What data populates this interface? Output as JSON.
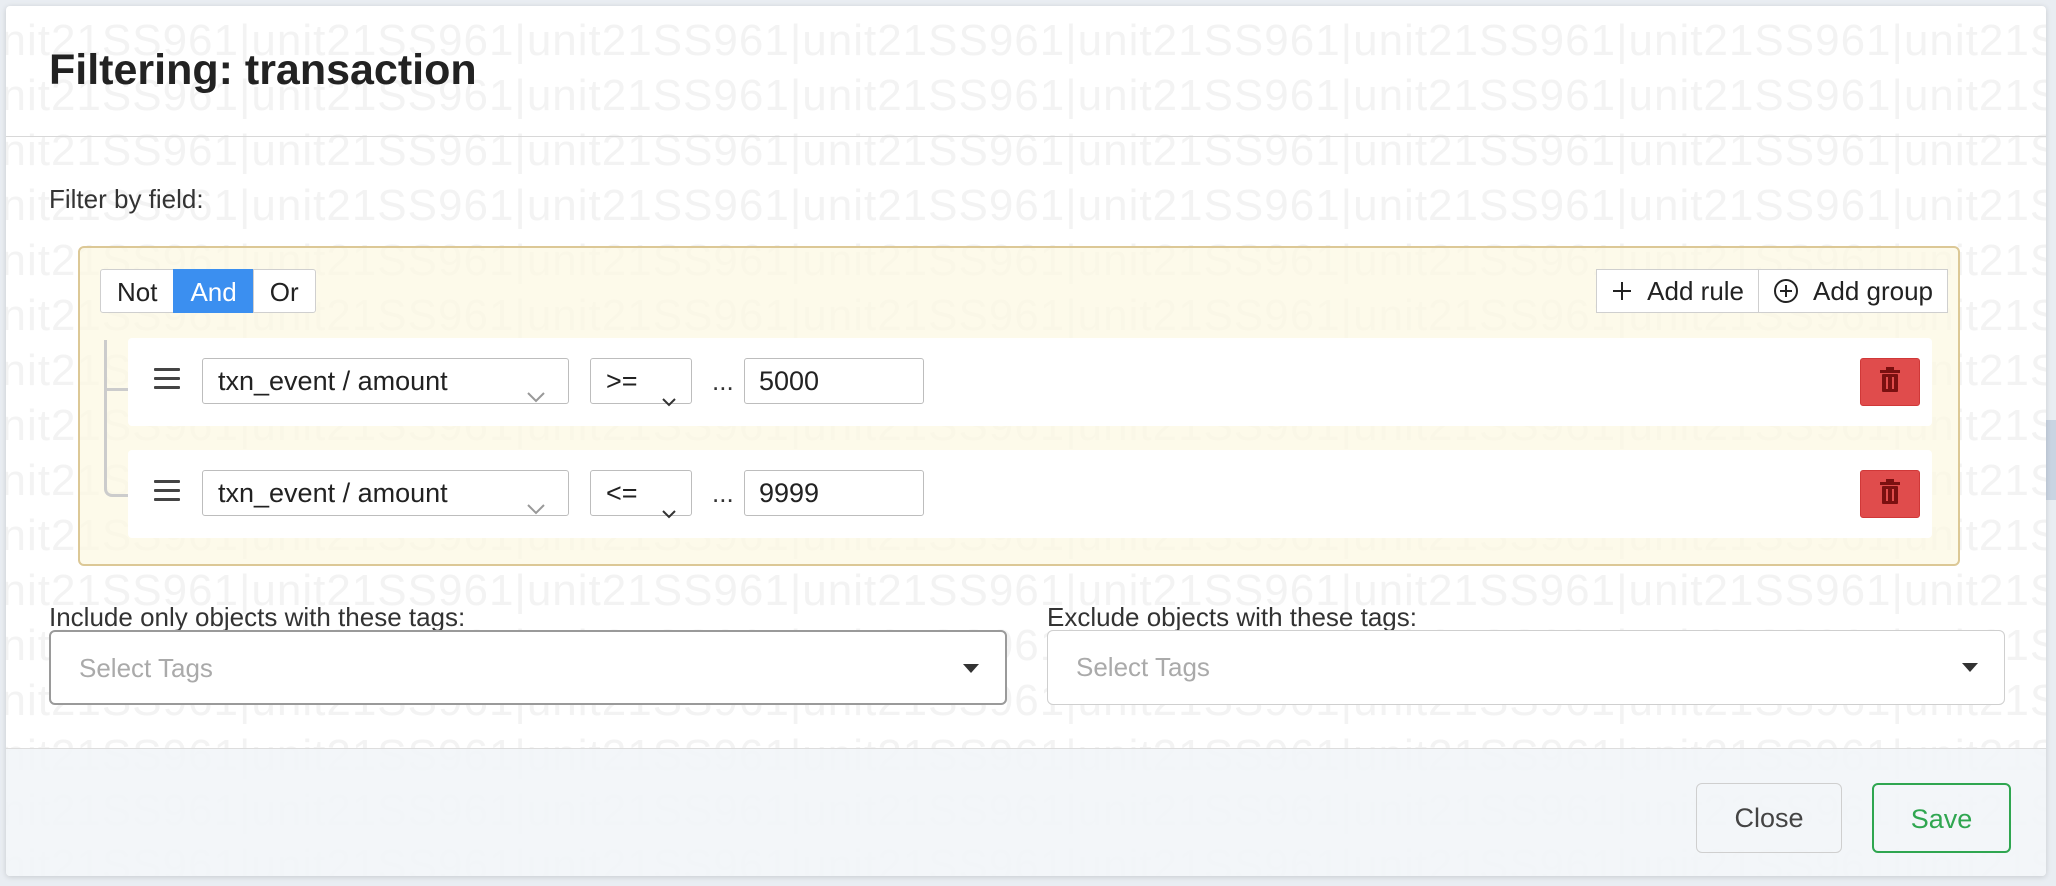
{
  "modal": {
    "title": "Filtering: transaction"
  },
  "watermark": {
    "text": "unit21SS961|"
  },
  "filter": {
    "label": "Filter by field:",
    "conjunctions": [
      {
        "label": "Not",
        "active": false
      },
      {
        "label": "And",
        "active": true
      },
      {
        "label": "Or",
        "active": false
      }
    ],
    "add_rule_label": "Add rule",
    "add_group_label": "Add group",
    "rules": [
      {
        "field": "txn_event / amount",
        "operator": ">=",
        "ellipsis": "...",
        "value": "5000"
      },
      {
        "field": "txn_event / amount",
        "operator": "<=",
        "ellipsis": "...",
        "value": "9999"
      }
    ]
  },
  "tags": {
    "include_label": "Include only objects with these tags:",
    "exclude_label": "Exclude objects with these tags:",
    "include_placeholder": "Select Tags",
    "exclude_placeholder": "Select Tags"
  },
  "footer": {
    "close_label": "Close",
    "save_label": "Save"
  },
  "colors": {
    "active_conjunction": "#3b8ff0",
    "delete_button": "#e04c4c",
    "save_accent": "#2fa650",
    "rule_group_bg": "#fcf8e3"
  }
}
